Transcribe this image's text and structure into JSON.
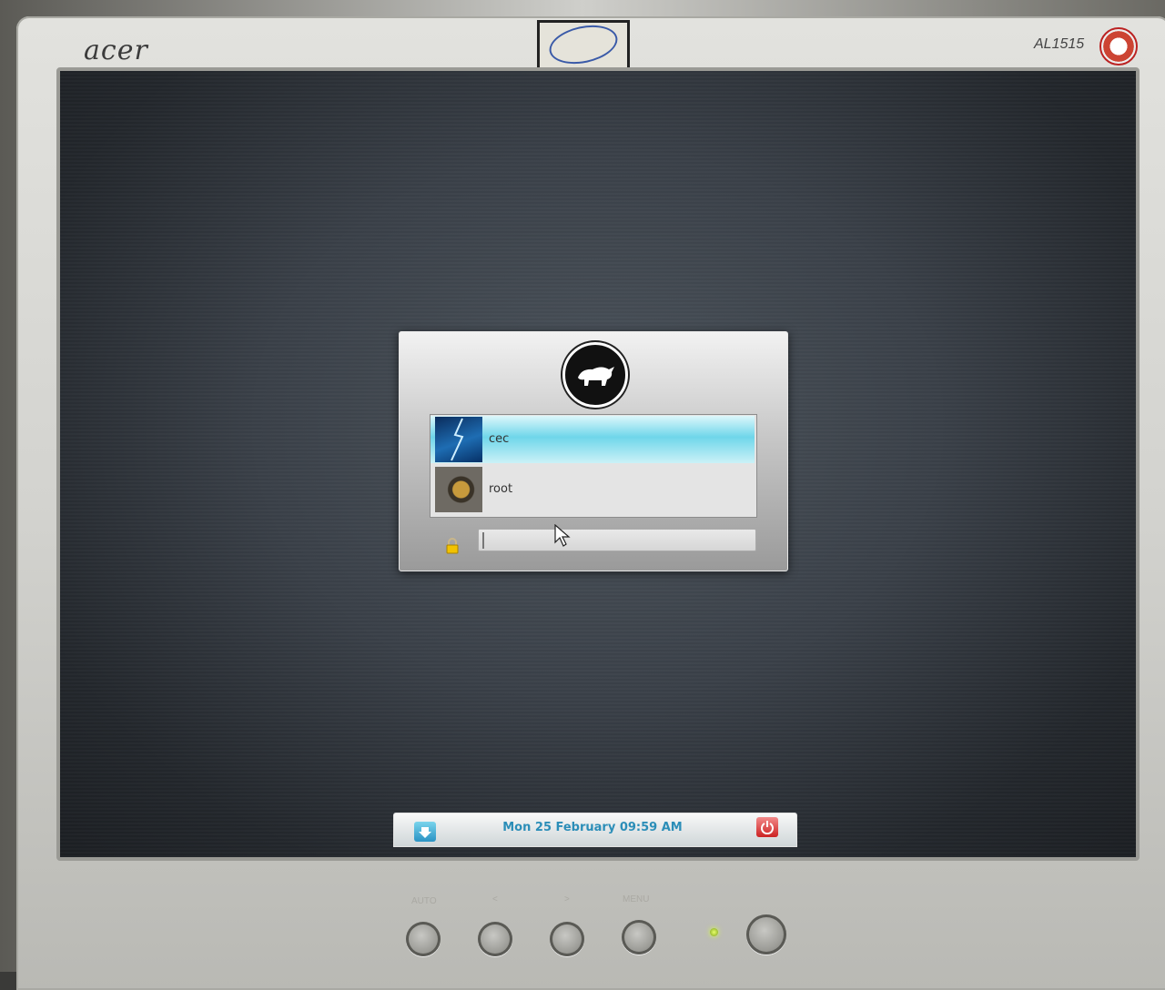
{
  "monitor": {
    "brand": "acer",
    "model": "AL1515",
    "buttons": [
      {
        "label": "AUTO"
      },
      {
        "label": "<"
      },
      {
        "label": ">"
      },
      {
        "label": "MENU"
      }
    ]
  },
  "login": {
    "users": [
      {
        "name": "cec",
        "avatar": "lightning-avatar",
        "selected": true
      },
      {
        "name": "root",
        "avatar": "cat-eye-avatar",
        "selected": false
      }
    ],
    "password": {
      "value": "",
      "placeholder": ""
    },
    "lock_icon": "lock-icon",
    "logo_icon": "bull-logo-icon"
  },
  "bottom_bar": {
    "clock": "Mon 25 February 09:59 AM",
    "menu_icon": "arrow-down-icon",
    "power_icon": "power-icon"
  },
  "colors": {
    "selection": "#6fd6ea",
    "clock_text": "#2c8eb8",
    "power": "#cc2323"
  }
}
